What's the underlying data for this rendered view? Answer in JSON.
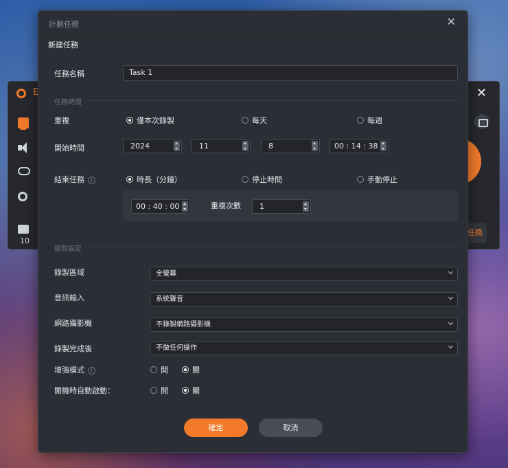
{
  "background_app": {
    "logo_text": "E",
    "folder_count": "10",
    "task_button": "任務"
  },
  "dialog": {
    "title": "計劃任務",
    "subtitle": "新建任務",
    "close": "✕",
    "task_name": {
      "label": "任務名稱",
      "value": "Task 1"
    },
    "task_time_section": "任務時間",
    "repeat": {
      "label": "重複",
      "options": [
        "僅本次錄製",
        "每天",
        "每週"
      ],
      "selected": 0
    },
    "start_time": {
      "label": "開始時間",
      "year": "2024",
      "month": "11",
      "day": "8",
      "time": "00 : 14 : 38"
    },
    "end_task": {
      "label": "結束任務",
      "info_icon": "i",
      "options": [
        "時長（分鐘）",
        "停止時間",
        "手動停止"
      ],
      "selected": 0,
      "duration": "00 : 40 : 00",
      "repeat_count_label": "重複次數",
      "repeat_count": "1"
    },
    "record_settings_section": "錄製設定",
    "record_area": {
      "label": "錄製區域",
      "value": "全螢幕"
    },
    "audio_input": {
      "label": "音訊輸入",
      "value": "系統聲音"
    },
    "webcam": {
      "label": "網路攝影機",
      "value": "不錄製網路攝影機"
    },
    "after_record": {
      "label": "錄製完成後",
      "value": "不做任何操作"
    },
    "enhanced_mode": {
      "label": "增強模式",
      "info_icon": "i",
      "options": [
        "開",
        "關"
      ],
      "selected": 1
    },
    "auto_start": {
      "label": "開機時自動啟動：",
      "options": [
        "開",
        "關"
      ],
      "selected": 1
    },
    "confirm_button": "確定",
    "cancel_button": "取消"
  },
  "colors": {
    "accent": "#f27a2a",
    "dialog_bg": "#2c2e35",
    "input_bg": "#23252b"
  }
}
